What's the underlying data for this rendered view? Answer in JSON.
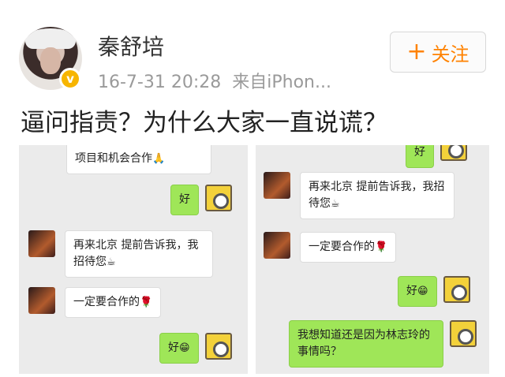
{
  "header": {
    "username": "秦舒培",
    "timestamp": "16-7-31 20:28",
    "source": "来自iPhon...",
    "follow_plus": "+",
    "follow_label": "关注",
    "verified_badge": "v"
  },
  "post": {
    "title": "逼问指责？为什么大家一直说谎？"
  },
  "chat_left": [
    {
      "side": "other",
      "text": "项目和机会合作",
      "emoji": "🙏"
    },
    {
      "side": "self",
      "text": "好",
      "emoji": ""
    },
    {
      "side": "other",
      "text": "再来北京 提前告诉我，我招待您",
      "emoji": "☕"
    },
    {
      "side": "other",
      "text": "一定要合作的",
      "emoji": "🌹"
    },
    {
      "side": "self",
      "text": "好",
      "emoji": "😁"
    }
  ],
  "chat_right": [
    {
      "side": "self",
      "text": "好",
      "emoji": ""
    },
    {
      "side": "other",
      "text": "再来北京 提前告诉我，我招待您",
      "emoji": "☕"
    },
    {
      "side": "other",
      "text": "一定要合作的",
      "emoji": "🌹"
    },
    {
      "side": "self",
      "text": "好",
      "emoji": "😁"
    },
    {
      "side": "self",
      "text": "我想知道还是因为林志玲的事情吗？",
      "emoji": ""
    }
  ],
  "colors": {
    "follow_orange": "#ff8200",
    "badge_yellow": "#f7b500",
    "self_bubble_green": "#9fe658",
    "chat_bg": "#ebebeb"
  }
}
